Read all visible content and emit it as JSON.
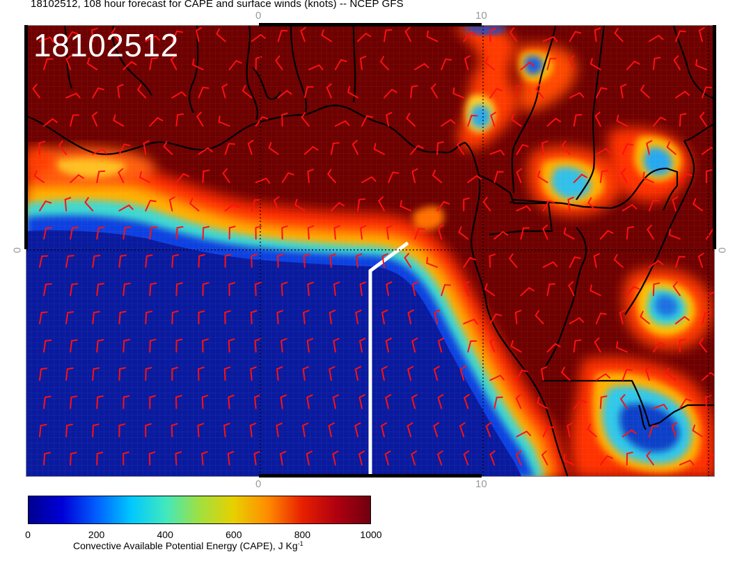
{
  "header": {
    "title": "18102512, 108 hour forecast for CAPE and surface winds (knots) -- NCEP GFS"
  },
  "map": {
    "date_stamp": "18102512",
    "field": "CAPE",
    "overlay": "surface wind barbs",
    "colors": {
      "ocean_low_cape": "#0a1a9e",
      "land_high_cape": "#6e0000",
      "wind_barbs": "#ff1010",
      "coastline": "#000000",
      "cross_section_line": "#ffffff"
    },
    "axis_labels": {
      "top": [
        "0",
        "10"
      ],
      "bottom": [
        "0",
        "10"
      ],
      "left": [
        "0"
      ],
      "right": [
        "0"
      ]
    }
  },
  "colorbar": {
    "title": "Convective Available Potential Energy (CAPE), J Kg",
    "title_exponent": "-1",
    "ticks": [
      "0",
      "200",
      "400",
      "600",
      "800",
      "1000"
    ],
    "range": [
      0,
      1000
    ],
    "stops": [
      "#000090",
      "#0000d8",
      "#0060ff",
      "#00c8ff",
      "#40e8c0",
      "#a0e040",
      "#e8d000",
      "#ff8c00",
      "#e82000",
      "#b00010",
      "#700010"
    ]
  }
}
